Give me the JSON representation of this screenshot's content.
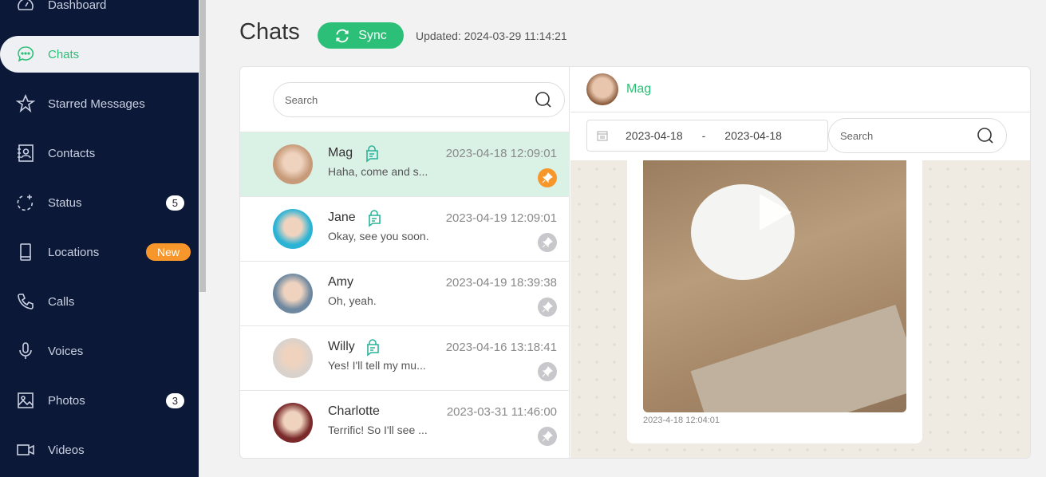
{
  "sidebar": {
    "items": [
      {
        "label": "Dashboard",
        "icon": "dashboard-icon"
      },
      {
        "label": "Chats",
        "icon": "chat-icon",
        "active": true
      },
      {
        "label": "Starred Messages",
        "icon": "star-icon"
      },
      {
        "label": "Contacts",
        "icon": "contacts-icon"
      },
      {
        "label": "Status",
        "icon": "status-icon",
        "badge": "5"
      },
      {
        "label": "Locations",
        "icon": "phone-device-icon",
        "badge": "New"
      },
      {
        "label": "Calls",
        "icon": "phone-icon"
      },
      {
        "label": "Voices",
        "icon": "microphone-icon"
      },
      {
        "label": "Photos",
        "icon": "image-icon",
        "badge": "3"
      },
      {
        "label": "Videos",
        "icon": "video-icon"
      }
    ]
  },
  "header": {
    "title": "Chats",
    "sync_label": "Sync",
    "updated": "Updated: 2024-03-29 11:14:21"
  },
  "list": {
    "search_placeholder": "Search",
    "chats": [
      {
        "name": "Mag",
        "time": "2023-04-18 12:09:01",
        "preview": "Haha, come and s...",
        "pinned": true,
        "selected": true,
        "avatar": "#c79b7a"
      },
      {
        "name": "Jane",
        "time": "2023-04-19 12:09:01",
        "preview": "Okay, see you soon.",
        "pinned": false,
        "avatar": "#2bb3d6"
      },
      {
        "name": "Amy",
        "time": "2023-04-19 18:39:38",
        "preview": "Oh, yeah.",
        "pinned": false,
        "avatar": "#6e88a0"
      },
      {
        "name": "Willy",
        "time": "2023-04-16 13:18:41",
        "preview": "Yes! I'll tell my mu...",
        "pinned": false,
        "avatar": "#d9d2cc"
      },
      {
        "name": "Charlotte",
        "time": "2023-03-31 11:46:00",
        "preview": "Terrific! So I'll see ...",
        "pinned": false,
        "avatar": "#7a2a2a"
      }
    ]
  },
  "chat": {
    "name": "Mag",
    "date_from": "2023-04-18",
    "date_sep": "-",
    "date_to": "2023-04-18",
    "search_placeholder": "Search",
    "message_time": "2023-4-18 12:04:01"
  },
  "colors": {
    "accent": "#2bbf77",
    "sidebar": "#0b1838",
    "badge_new": "#f7962b"
  }
}
